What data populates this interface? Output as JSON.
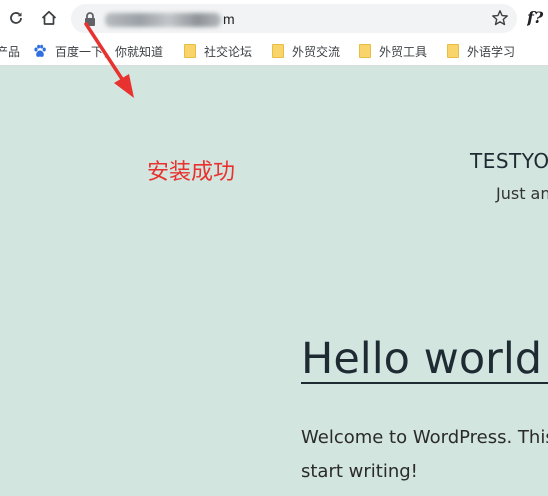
{
  "browser": {
    "url_visible_suffix": "m",
    "ext_label": "f?"
  },
  "bookmarks": {
    "items": [
      {
        "label": "产品",
        "icon": "none"
      },
      {
        "label": "百度一下，你就知道",
        "icon": "baidu-paw-icon"
      },
      {
        "label": "社交论坛",
        "icon": "folder-icon"
      },
      {
        "label": "外贸交流",
        "icon": "folder-icon"
      },
      {
        "label": "外贸工具",
        "icon": "folder-icon"
      },
      {
        "label": "外语学习",
        "icon": "folder-icon"
      }
    ]
  },
  "page": {
    "site_title": "TESTYO",
    "tagline": "Just an",
    "post_title": "Hello world",
    "post_body_line1": "Welcome to WordPress. This",
    "post_body_line2": "start writing!"
  },
  "annotation": {
    "text": "安装成功",
    "color": "#e8322f"
  },
  "colors": {
    "page_bg": "#d3e5df",
    "chrome_bg": "#ffffff",
    "omnibox_bg": "#f1f3f4",
    "folder": "#f8d46b"
  }
}
